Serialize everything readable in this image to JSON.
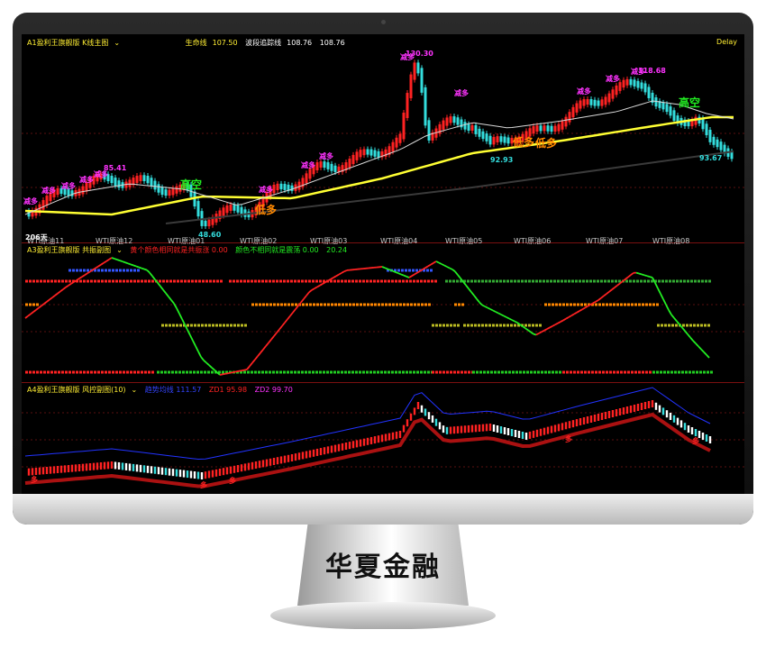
{
  "brand": "华夏金融",
  "panel1": {
    "title": "A1盈利王旗舰版 K线主图",
    "line1_label": "生命线",
    "line1_value": "107.50",
    "line2_label": "波段追踪线",
    "line2_value": "108.76",
    "line3_value": "108.76",
    "delay": "Delay",
    "high_label": "130.30",
    "high2_label": "118.68",
    "price_85": "85.41",
    "low_label": "92.93",
    "last_label": "93.67",
    "bottom_label": "48.60",
    "tick_206": "206天",
    "jian_duo": "减多",
    "gao_kong": "高空",
    "di_duo": "低多",
    "dates": [
      "WTI原油11",
      "WTI原油12",
      "WTI原油01",
      "WTI原油02",
      "WTI原油03",
      "WTI原油04",
      "WTI原油05",
      "WTI原油06",
      "WTI原油07",
      "WTI原油08"
    ]
  },
  "panel2": {
    "title": "A3盈利王旗舰版 共振副图",
    "item1": "黄个颜色相同就是共振涨 0.00",
    "item2": "颜色不相同就是震荡 0.00",
    "item3": "20.24"
  },
  "panel3": {
    "title": "A4盈利王旗舰版 风控副图(10)",
    "item1": "趋势均线 111.57",
    "item2": "ZD1 95.98",
    "item3": "ZD2 99.70",
    "duo": "多"
  },
  "colors": {
    "bg": "#000000",
    "life_line": "#ffff33",
    "trend_line": "#d8d8d8",
    "up": "#ff2222",
    "down": "#33dddd",
    "green": "#22ee22",
    "orange": "#ff8800",
    "magenta": "#ff33ff",
    "blue": "#3344ff"
  }
}
